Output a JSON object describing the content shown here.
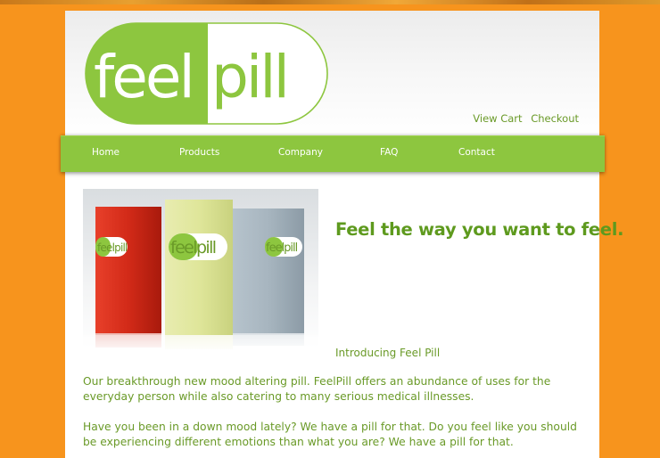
{
  "brand": {
    "logo_left": "feel",
    "logo_right": "pill",
    "box_label": "feelpill",
    "green": "#8dc63f",
    "orange": "#f7941d"
  },
  "header_links": {
    "view_cart": "View Cart",
    "checkout": "Checkout"
  },
  "nav": {
    "items": [
      {
        "label": "Home"
      },
      {
        "label": "Products"
      },
      {
        "label": "Company"
      },
      {
        "label": "FAQ"
      },
      {
        "label": "Contact"
      }
    ]
  },
  "main": {
    "headline": "Feel the way you want to feel.",
    "intro": "Introducing Feel Pill",
    "paragraphs": [
      "Our breakthrough new mood altering pill. FeelPill offers an abundance of uses for the everyday person while also catering to many serious medical illnesses.",
      "Have you been in a down mood lately? We have a pill for that. Do you feel like you should be experiencing different emotions than what you are? We have a pill for that."
    ]
  }
}
